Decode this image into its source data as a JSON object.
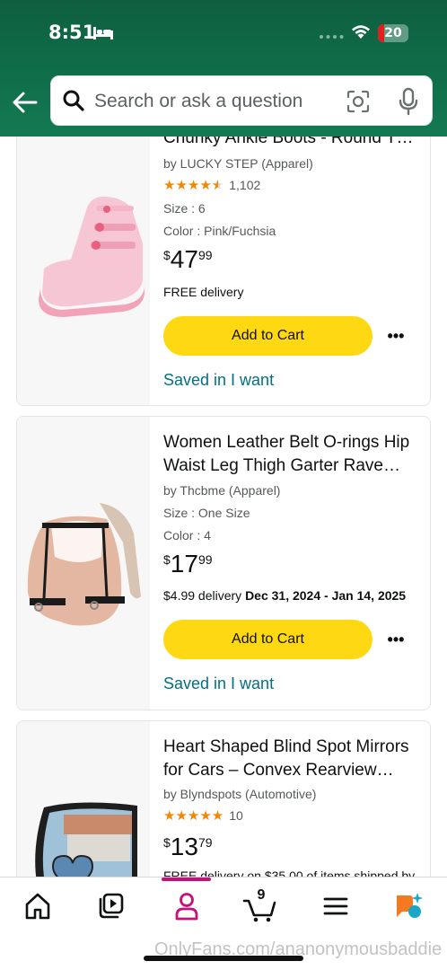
{
  "status_bar": {
    "time": "8:51",
    "battery": "20",
    "battery_level": 0.2
  },
  "search": {
    "placeholder": "Search or ask a question"
  },
  "products": [
    {
      "title": "Chunky Ankle Boots - Round T…",
      "byline": "by LUCKY STEP (Apparel)",
      "rating": 4.5,
      "rating_count": "1,102",
      "size": "Size : 6",
      "color": "Color : Pink/Fuchsia",
      "price_currency": "$",
      "price_whole": "47",
      "price_fraction": "99",
      "delivery": "FREE delivery",
      "add_to_cart": "Add to Cart",
      "saved": "Saved in I want",
      "more": "•••",
      "image": "pink-platform-boot-icon"
    },
    {
      "title": "Women Leather Belt O-rings Hip Waist Leg Thigh Garter Rave…",
      "byline": "by Thcbme (Apparel)",
      "size": "Size : One Size",
      "color": "Color : 4",
      "price_currency": "$",
      "price_whole": "17",
      "price_fraction": "99",
      "delivery_prefix": "$4.99 delivery ",
      "delivery_dates": "Dec 31, 2024 - Jan 14, 2025",
      "add_to_cart": "Add to Cart",
      "saved": "Saved in I want",
      "more": "•••",
      "image": "leather-garter-belt-icon"
    },
    {
      "title": "Heart Shaped Blind Spot Mirrors for Cars – Convex Rearview…",
      "byline": "by Blyndspots (Automotive)",
      "rating": 5,
      "rating_count": "10",
      "price_currency": "$",
      "price_whole": "13",
      "price_fraction": "79",
      "delivery": "FREE delivery on $35.00 of items shipped by",
      "image": "car-mirror-icon"
    }
  ],
  "bottom_nav": {
    "items": [
      "home-icon",
      "video-icon",
      "profile-icon",
      "cart-icon",
      "menu-icon",
      "ai-assistant-icon"
    ],
    "active": "profile-icon",
    "cart_count": "9"
  },
  "watermark": "OnlyFans.com/ananonymousbaddie",
  "colors": {
    "header": "#127a52",
    "add_to_cart": "#ffd814",
    "link": "#007185",
    "active_tab": "#c7107b",
    "star": "#f08804"
  }
}
